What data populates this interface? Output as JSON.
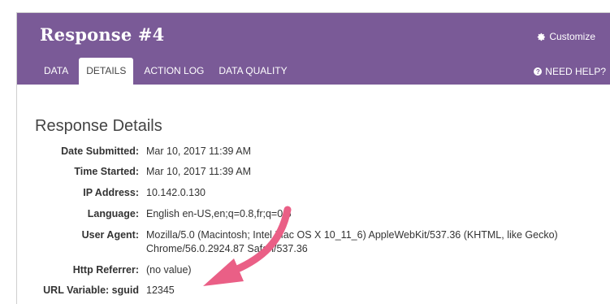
{
  "header": {
    "title": "Response #4",
    "customize_label": "Customize",
    "help_label": "NEED HELP?"
  },
  "tabs": [
    {
      "label": "DATA",
      "active": false
    },
    {
      "label": "DETAILS",
      "active": true
    },
    {
      "label": "ACTION LOG",
      "active": false
    },
    {
      "label": "DATA QUALITY",
      "active": false
    }
  ],
  "section": {
    "title": "Response Details"
  },
  "details": [
    {
      "label": "Date Submitted:",
      "value": "Mar 10, 2017 11:39 AM"
    },
    {
      "label": "Time Started:",
      "value": "Mar 10, 2017 11:39 AM"
    },
    {
      "label": "IP Address:",
      "value": "10.142.0.130"
    },
    {
      "label": "Language:",
      "value": "English en-US,en;q=0.8,fr;q=0.6"
    },
    {
      "label": "User Agent:",
      "value": "Mozilla/5.0 (Macintosh; Intel Mac OS X 10_11_6) AppleWebKit/537.36 (KHTML, like Gecko) Chrome/56.0.2924.87 Safari/537.36"
    },
    {
      "label": "Http Referrer:",
      "value": "(no value)"
    },
    {
      "label": "URL Variable: sguid",
      "value": "12345"
    }
  ],
  "colors": {
    "header_bg": "#7a5a97",
    "arrow": "#ea5f86"
  },
  "icons": {
    "customize": "gear-icon",
    "help": "question-circle-icon"
  }
}
